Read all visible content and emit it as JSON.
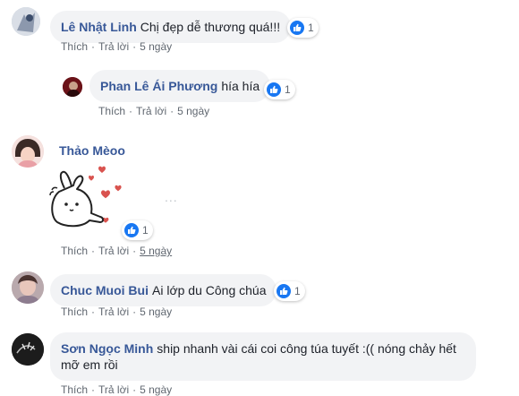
{
  "comments": [
    {
      "author": "Lê Nhật Linh",
      "text": "Chị đẹp dễ thương quá!!!",
      "reactions": "1",
      "like_label": "Thích",
      "reply_label": "Trả lời",
      "time": "5 ngày"
    },
    {
      "author": "Phan Lê Ái Phương",
      "text": "hía hía",
      "reactions": "1",
      "like_label": "Thích",
      "reply_label": "Trả lời",
      "time": "5 ngày"
    },
    {
      "author": "Thảo Mèoo",
      "sticker_icon": "bunny-hearts-sticker",
      "reactions": "1",
      "like_label": "Thích",
      "reply_label": "Trả lời",
      "time": "5 ngày"
    },
    {
      "author": "Chuc Muoi Bui",
      "text": "Ai lớp du Công chúa",
      "reactions": "1",
      "like_label": "Thích",
      "reply_label": "Trả lời",
      "time": "5 ngày"
    },
    {
      "author": "Sơn Ngọc Minh",
      "text": "ship nhanh vài cái coi công túa tuyết :(( nóng chảy hết mỡ em rồi",
      "like_label": "Thích",
      "reply_label": "Trả lời",
      "time": "5 ngày"
    }
  ],
  "separator": "·",
  "more_options": "...",
  "colors": {
    "link": "#385898",
    "like_blue": "#1877f2",
    "bubble": "#f2f3f5",
    "meta": "#606770"
  },
  "icons": {
    "reaction": "like-icon",
    "more": "more-options-icon"
  }
}
